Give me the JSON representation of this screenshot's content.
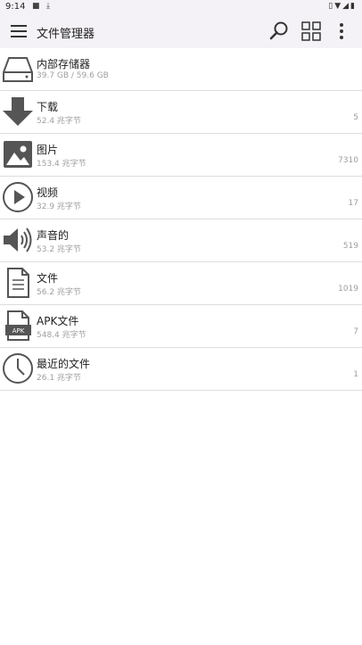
{
  "status_bar": {
    "time": "9:14"
  },
  "app_bar": {
    "title": "文件管理器"
  },
  "items": [
    {
      "icon": "drive-icon",
      "name": "内部存储器",
      "size": "39.7 GB / 59.6 GB",
      "count": ""
    },
    {
      "icon": "download-icon",
      "name": "下载",
      "size": "52.4 兆字节",
      "count": "5"
    },
    {
      "icon": "image-icon",
      "name": "图片",
      "size": "153.4 兆字节",
      "count": "7310"
    },
    {
      "icon": "play-icon",
      "name": "视频",
      "size": "32.9 兆字节",
      "count": "17"
    },
    {
      "icon": "speaker-icon",
      "name": "声音的",
      "size": "53.2 兆字节",
      "count": "519"
    },
    {
      "icon": "document-icon",
      "name": "文件",
      "size": "56.2 兆字节",
      "count": "1019"
    },
    {
      "icon": "apk-icon",
      "name": "APK文件",
      "size": "548.4 兆字节",
      "count": "7",
      "icon_label": "APK"
    },
    {
      "icon": "clock-icon",
      "name": "最近的文件",
      "size": "26.1 兆字节",
      "count": "1"
    }
  ]
}
